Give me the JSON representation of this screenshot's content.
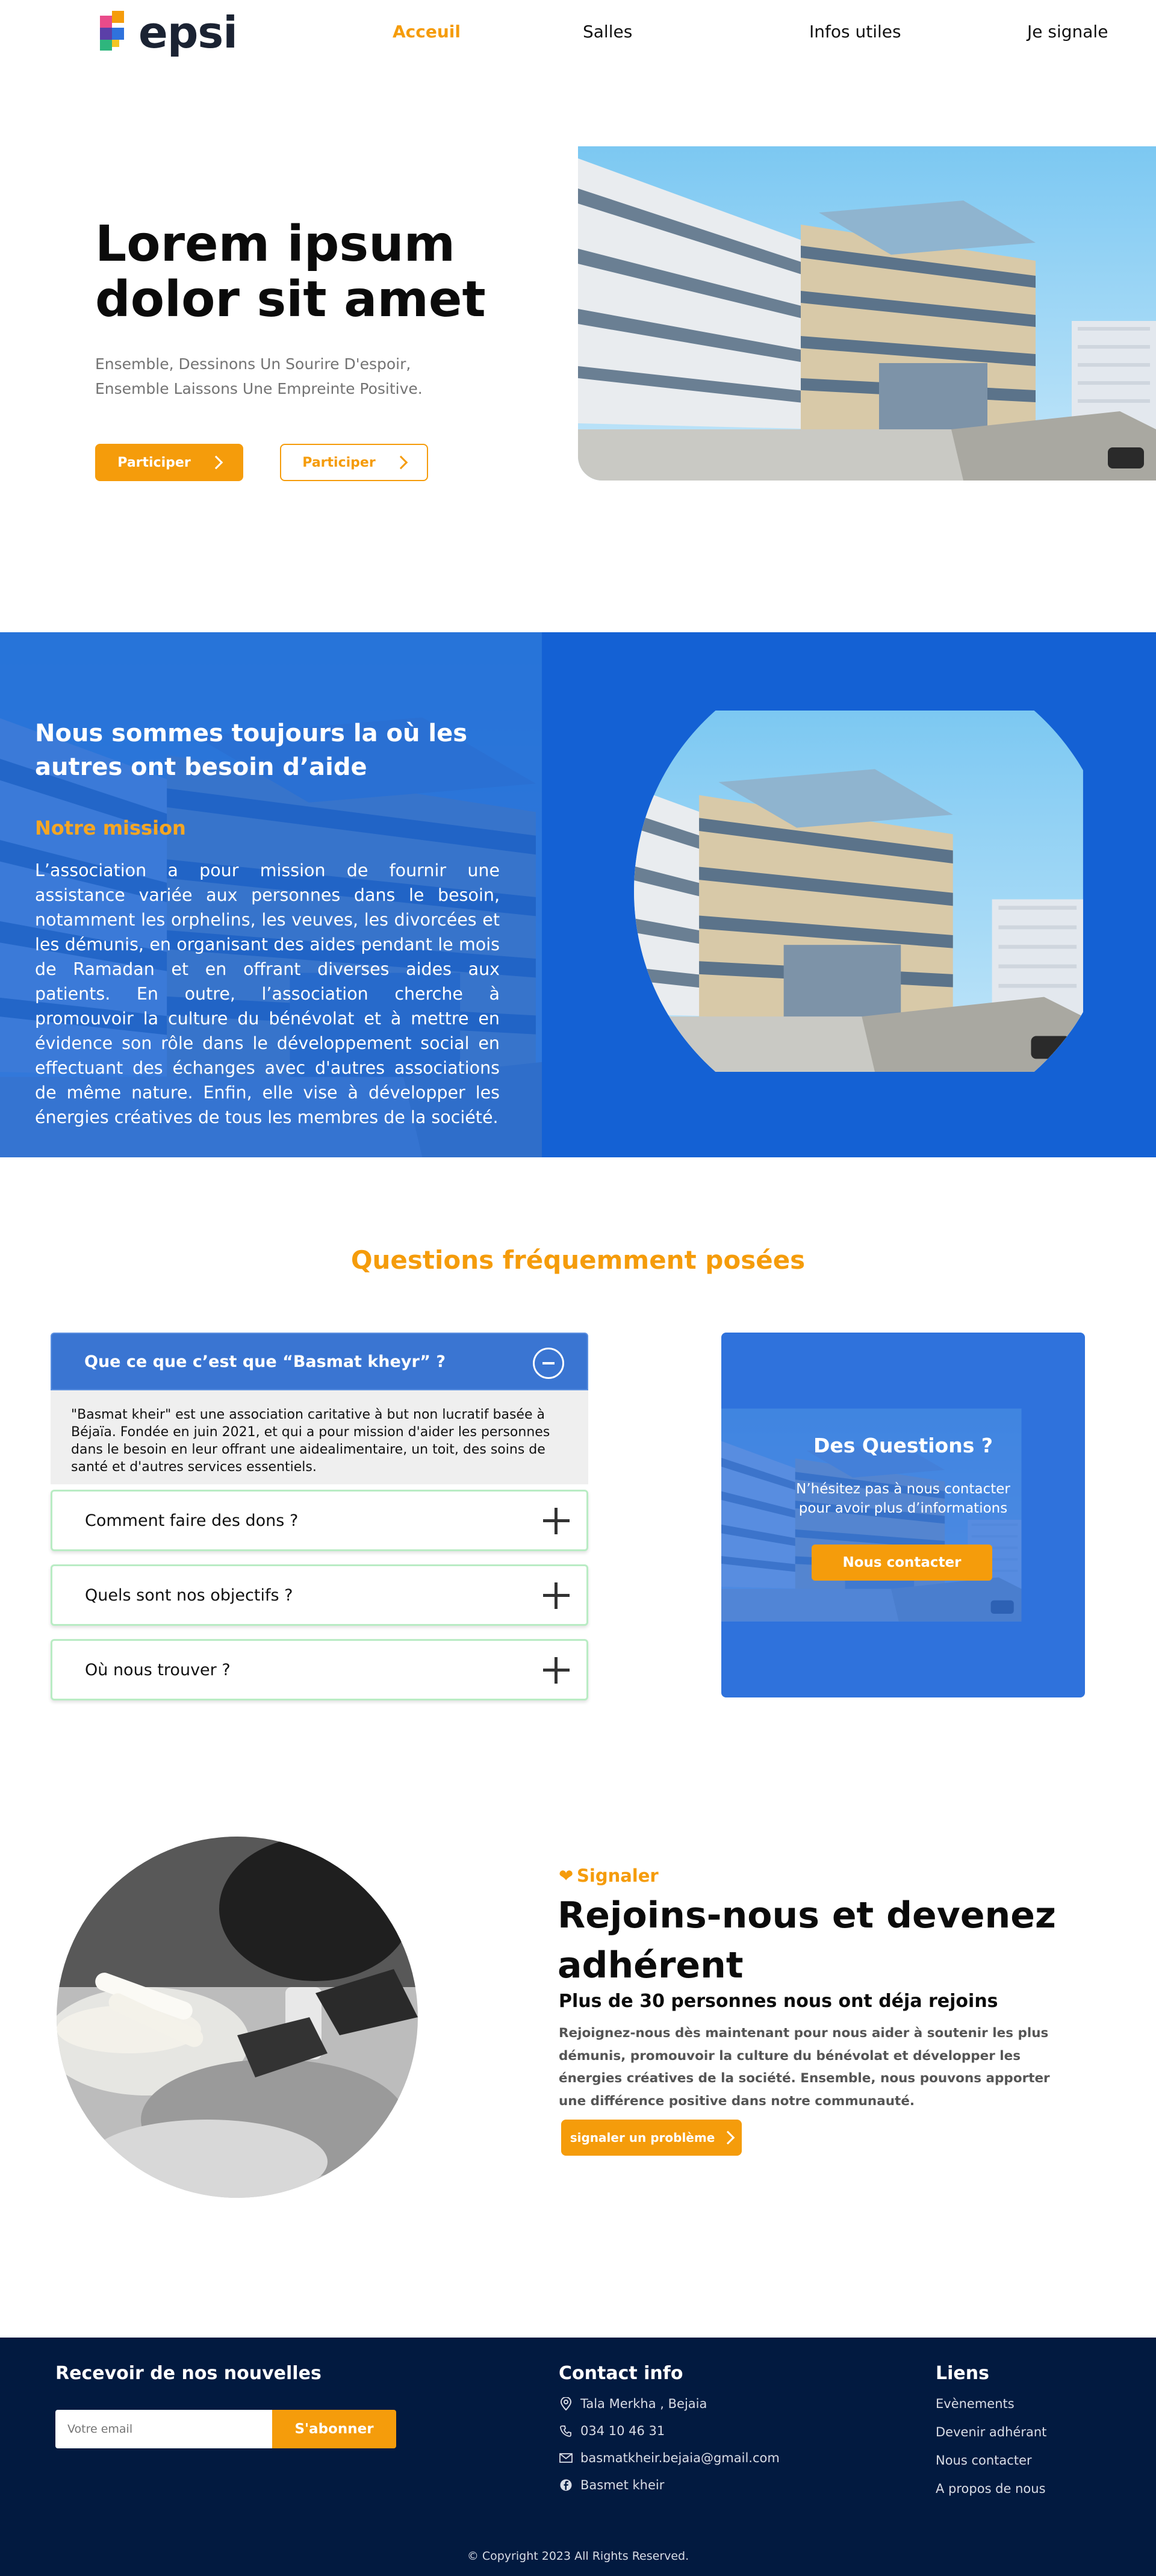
{
  "nav": {
    "logo_text": "epsi",
    "links": [
      "Acceuil",
      "Salles",
      "Infos utiles",
      "Je signale"
    ],
    "active_color": "#f59c0b"
  },
  "hero": {
    "title_line1": "Lorem ipsum",
    "title_line2": "dolor sit amet",
    "subtitle_line1": "Ensemble, Dessinons Un Sourire D'espoir,",
    "subtitle_line2": "Ensemble Laissons Une Empreinte Positive.",
    "primary_button": "Participer",
    "secondary_button": "Participer"
  },
  "mission": {
    "title_line1": "Nous sommes toujours la où les",
    "title_line2": "autres ont besoin d’aide",
    "subtitle": "Notre mission",
    "text": "L’association a pour mission de fournir une assistance variée aux personnes dans le besoin, notamment les orphelins, les veuves, les divorcées et les démunis, en organisant des aides pendant le mois de Ramadan et en offrant diverses aides aux patients. En outre, l’association cherche à promouvoir la culture du bénévolat et à mettre en évidence son rôle dans le développement social en effectuant des échanges avec d'autres associations de même nature. Enfin, elle vise à développer les énergies créatives de tous les membres de la société."
  },
  "faq": {
    "title": "Questions fréquemment posées",
    "open_question": "Que ce que c’est que “Basmat kheyr” ?",
    "open_answer": "\"Basmat kheir\" est une association caritative à but non lucratif basée à Béjaïa. Fondée en juin 2021, et qui a pour mission d'aider les personnes dans le besoin en leur offrant une aidealimentaire, un toit, des soins de santé et d'autres services essentiels.",
    "questions": [
      "Comment faire des dons ?",
      "Quels sont nos objectifs ?",
      "Où nous trouver ?"
    ]
  },
  "contact_card": {
    "title": "Des Questions ?",
    "text_line1": "N’hésitez pas à nous contacter",
    "text_line2": "pour avoir plus d’informations",
    "button": "Nous contacter"
  },
  "join": {
    "tag": "Signaler",
    "title_line1": "Rejoins-nous et devenez",
    "title_line2": "adhérent",
    "subtitle": "Plus de 30 personnes nous ont déja rejoins",
    "text": "Rejoignez-nous dès maintenant pour nous aider à soutenir les plus démunis, promouvoir la culture du bénévolat et développer les énergies créatives de la société. Ensemble, nous pouvons apporter une différence positive dans notre communauté.",
    "button": "signaler un problème"
  },
  "footer": {
    "newsletter_title": "Recevoir de nos nouvelles",
    "email_placeholder": "Votre email",
    "subscribe_button": "S'abonner",
    "contact_title": "Contact  info",
    "contact_items": [
      {
        "icon": "location-pin-icon",
        "text": "Tala Merkha , Bejaia"
      },
      {
        "icon": "phone-icon",
        "text": "034 10 46 31"
      },
      {
        "icon": "mail-icon",
        "text": "basmatkheir.bejaia@gmail.com"
      },
      {
        "icon": "facebook-icon",
        "text": "Basmet kheir"
      }
    ],
    "links_title": "Liens",
    "links": [
      "Evènements",
      "Devenir adhérant",
      "Nous contacter",
      "A propos de nous"
    ],
    "copyright": "© Copyright 2023  All Rights Reserved."
  },
  "colors": {
    "accent": "#f59c0b",
    "mission_bg": "#1461d4",
    "card_bg": "#2f72dc",
    "footer_bg": "#021a40"
  }
}
